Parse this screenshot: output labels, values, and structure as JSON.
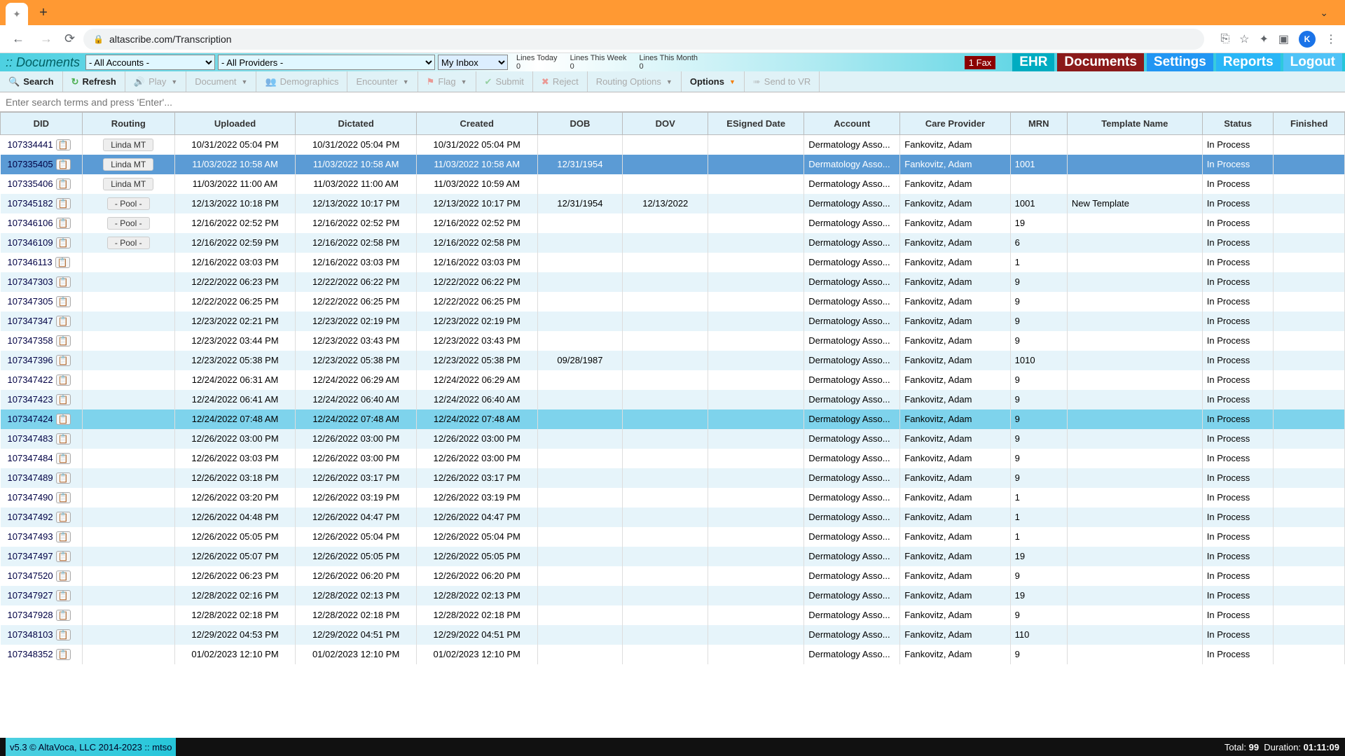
{
  "browser": {
    "url": "altascribe.com/Transcription"
  },
  "header": {
    "title": ":: Documents",
    "accounts": "- All Accounts -",
    "providers": "- All Providers -",
    "inbox": "My Inbox",
    "stats": [
      {
        "label": "Lines Today",
        "value": "0"
      },
      {
        "label": "Lines This Week",
        "value": "0"
      },
      {
        "label": "Lines This Month",
        "value": "0"
      }
    ],
    "fax": "1 Fax",
    "nav": {
      "ehr": "EHR",
      "documents": "Documents",
      "settings": "Settings",
      "reports": "Reports",
      "logout": "Logout"
    }
  },
  "toolbar": {
    "search": "Search",
    "refresh": "Refresh",
    "play": "Play",
    "document": "Document",
    "demographics": "Demographics",
    "encounter": "Encounter",
    "flag": "Flag",
    "submit": "Submit",
    "reject": "Reject",
    "routing": "Routing Options",
    "options": "Options",
    "sendvr": "Send to VR"
  },
  "search_placeholder": "Enter search terms and press 'Enter'...",
  "columns": [
    "DID",
    "Routing",
    "Uploaded",
    "Dictated",
    "Created",
    "DOB",
    "DOV",
    "ESigned Date",
    "Account",
    "Care Provider",
    "MRN",
    "Template Name",
    "Status",
    "Finished"
  ],
  "rows": [
    {
      "did": "107334441",
      "routing": "Linda MT",
      "uploaded": "10/31/2022 05:04 PM",
      "dictated": "10/31/2022 05:04 PM",
      "created": "10/31/2022 05:04 PM",
      "dob": "",
      "dov": "",
      "esig": "",
      "acct": "Dermatology Asso...",
      "prov": "Fankovitz, Adam",
      "mrn": "",
      "tmpl": "",
      "status": "In Process",
      "fin": "",
      "sel": ""
    },
    {
      "did": "107335405",
      "routing": "Linda MT",
      "uploaded": "11/03/2022 10:58 AM",
      "dictated": "11/03/2022 10:58 AM",
      "created": "11/03/2022 10:58 AM",
      "dob": "12/31/1954",
      "dov": "",
      "esig": "",
      "acct": "Dermatology Asso...",
      "prov": "Fankovitz, Adam",
      "mrn": "1001",
      "tmpl": "",
      "status": "In Process",
      "fin": "",
      "sel": "dark"
    },
    {
      "did": "107335406",
      "routing": "Linda MT",
      "uploaded": "11/03/2022 11:00 AM",
      "dictated": "11/03/2022 11:00 AM",
      "created": "11/03/2022 10:59 AM",
      "dob": "",
      "dov": "",
      "esig": "",
      "acct": "Dermatology Asso...",
      "prov": "Fankovitz, Adam",
      "mrn": "",
      "tmpl": "",
      "status": "In Process",
      "fin": "",
      "sel": ""
    },
    {
      "did": "107345182",
      "routing": "- Pool -",
      "uploaded": "12/13/2022 10:18 PM",
      "dictated": "12/13/2022 10:17 PM",
      "created": "12/13/2022 10:17 PM",
      "dob": "12/31/1954",
      "dov": "12/13/2022",
      "esig": "",
      "acct": "Dermatology Asso...",
      "prov": "Fankovitz, Adam",
      "mrn": "1001",
      "tmpl": "New Template",
      "status": "In Process",
      "fin": "",
      "sel": ""
    },
    {
      "did": "107346106",
      "routing": "- Pool -",
      "uploaded": "12/16/2022 02:52 PM",
      "dictated": "12/16/2022 02:52 PM",
      "created": "12/16/2022 02:52 PM",
      "dob": "",
      "dov": "",
      "esig": "",
      "acct": "Dermatology Asso...",
      "prov": "Fankovitz, Adam",
      "mrn": "19",
      "tmpl": "",
      "status": "In Process",
      "fin": "",
      "sel": ""
    },
    {
      "did": "107346109",
      "routing": "- Pool -",
      "uploaded": "12/16/2022 02:59 PM",
      "dictated": "12/16/2022 02:58 PM",
      "created": "12/16/2022 02:58 PM",
      "dob": "",
      "dov": "",
      "esig": "",
      "acct": "Dermatology Asso...",
      "prov": "Fankovitz, Adam",
      "mrn": "6",
      "tmpl": "",
      "status": "In Process",
      "fin": "",
      "sel": ""
    },
    {
      "did": "107346113",
      "routing": "",
      "uploaded": "12/16/2022 03:03 PM",
      "dictated": "12/16/2022 03:03 PM",
      "created": "12/16/2022 03:03 PM",
      "dob": "",
      "dov": "",
      "esig": "",
      "acct": "Dermatology Asso...",
      "prov": "Fankovitz, Adam",
      "mrn": "1",
      "tmpl": "",
      "status": "In Process",
      "fin": "",
      "sel": ""
    },
    {
      "did": "107347303",
      "routing": "",
      "uploaded": "12/22/2022 06:23 PM",
      "dictated": "12/22/2022 06:22 PM",
      "created": "12/22/2022 06:22 PM",
      "dob": "",
      "dov": "",
      "esig": "",
      "acct": "Dermatology Asso...",
      "prov": "Fankovitz, Adam",
      "mrn": "9",
      "tmpl": "",
      "status": "In Process",
      "fin": "",
      "sel": ""
    },
    {
      "did": "107347305",
      "routing": "",
      "uploaded": "12/22/2022 06:25 PM",
      "dictated": "12/22/2022 06:25 PM",
      "created": "12/22/2022 06:25 PM",
      "dob": "",
      "dov": "",
      "esig": "",
      "acct": "Dermatology Asso...",
      "prov": "Fankovitz, Adam",
      "mrn": "9",
      "tmpl": "",
      "status": "In Process",
      "fin": "",
      "sel": ""
    },
    {
      "did": "107347347",
      "routing": "",
      "uploaded": "12/23/2022 02:21 PM",
      "dictated": "12/23/2022 02:19 PM",
      "created": "12/23/2022 02:19 PM",
      "dob": "",
      "dov": "",
      "esig": "",
      "acct": "Dermatology Asso...",
      "prov": "Fankovitz, Adam",
      "mrn": "9",
      "tmpl": "",
      "status": "In Process",
      "fin": "",
      "sel": ""
    },
    {
      "did": "107347358",
      "routing": "",
      "uploaded": "12/23/2022 03:44 PM",
      "dictated": "12/23/2022 03:43 PM",
      "created": "12/23/2022 03:43 PM",
      "dob": "",
      "dov": "",
      "esig": "",
      "acct": "Dermatology Asso...",
      "prov": "Fankovitz, Adam",
      "mrn": "9",
      "tmpl": "",
      "status": "In Process",
      "fin": "",
      "sel": ""
    },
    {
      "did": "107347396",
      "routing": "",
      "uploaded": "12/23/2022 05:38 PM",
      "dictated": "12/23/2022 05:38 PM",
      "created": "12/23/2022 05:38 PM",
      "dob": "09/28/1987",
      "dov": "",
      "esig": "",
      "acct": "Dermatology Asso...",
      "prov": "Fankovitz, Adam",
      "mrn": "1010",
      "tmpl": "",
      "status": "In Process",
      "fin": "",
      "sel": ""
    },
    {
      "did": "107347422",
      "routing": "",
      "uploaded": "12/24/2022 06:31 AM",
      "dictated": "12/24/2022 06:29 AM",
      "created": "12/24/2022 06:29 AM",
      "dob": "",
      "dov": "",
      "esig": "",
      "acct": "Dermatology Asso...",
      "prov": "Fankovitz, Adam",
      "mrn": "9",
      "tmpl": "",
      "status": "In Process",
      "fin": "",
      "sel": ""
    },
    {
      "did": "107347423",
      "routing": "",
      "uploaded": "12/24/2022 06:41 AM",
      "dictated": "12/24/2022 06:40 AM",
      "created": "12/24/2022 06:40 AM",
      "dob": "",
      "dov": "",
      "esig": "",
      "acct": "Dermatology Asso...",
      "prov": "Fankovitz, Adam",
      "mrn": "9",
      "tmpl": "",
      "status": "In Process",
      "fin": "",
      "sel": ""
    },
    {
      "did": "107347424",
      "routing": "",
      "uploaded": "12/24/2022 07:48 AM",
      "dictated": "12/24/2022 07:48 AM",
      "created": "12/24/2022 07:48 AM",
      "dob": "",
      "dov": "",
      "esig": "",
      "acct": "Dermatology Asso...",
      "prov": "Fankovitz, Adam",
      "mrn": "9",
      "tmpl": "",
      "status": "In Process",
      "fin": "",
      "sel": "light"
    },
    {
      "did": "107347483",
      "routing": "",
      "uploaded": "12/26/2022 03:00 PM",
      "dictated": "12/26/2022 03:00 PM",
      "created": "12/26/2022 03:00 PM",
      "dob": "",
      "dov": "",
      "esig": "",
      "acct": "Dermatology Asso...",
      "prov": "Fankovitz, Adam",
      "mrn": "9",
      "tmpl": "",
      "status": "In Process",
      "fin": "",
      "sel": ""
    },
    {
      "did": "107347484",
      "routing": "",
      "uploaded": "12/26/2022 03:03 PM",
      "dictated": "12/26/2022 03:00 PM",
      "created": "12/26/2022 03:00 PM",
      "dob": "",
      "dov": "",
      "esig": "",
      "acct": "Dermatology Asso...",
      "prov": "Fankovitz, Adam",
      "mrn": "9",
      "tmpl": "",
      "status": "In Process",
      "fin": "",
      "sel": ""
    },
    {
      "did": "107347489",
      "routing": "",
      "uploaded": "12/26/2022 03:18 PM",
      "dictated": "12/26/2022 03:17 PM",
      "created": "12/26/2022 03:17 PM",
      "dob": "",
      "dov": "",
      "esig": "",
      "acct": "Dermatology Asso...",
      "prov": "Fankovitz, Adam",
      "mrn": "9",
      "tmpl": "",
      "status": "In Process",
      "fin": "",
      "sel": ""
    },
    {
      "did": "107347490",
      "routing": "",
      "uploaded": "12/26/2022 03:20 PM",
      "dictated": "12/26/2022 03:19 PM",
      "created": "12/26/2022 03:19 PM",
      "dob": "",
      "dov": "",
      "esig": "",
      "acct": "Dermatology Asso...",
      "prov": "Fankovitz, Adam",
      "mrn": "1",
      "tmpl": "",
      "status": "In Process",
      "fin": "",
      "sel": ""
    },
    {
      "did": "107347492",
      "routing": "",
      "uploaded": "12/26/2022 04:48 PM",
      "dictated": "12/26/2022 04:47 PM",
      "created": "12/26/2022 04:47 PM",
      "dob": "",
      "dov": "",
      "esig": "",
      "acct": "Dermatology Asso...",
      "prov": "Fankovitz, Adam",
      "mrn": "1",
      "tmpl": "",
      "status": "In Process",
      "fin": "",
      "sel": ""
    },
    {
      "did": "107347493",
      "routing": "",
      "uploaded": "12/26/2022 05:05 PM",
      "dictated": "12/26/2022 05:04 PM",
      "created": "12/26/2022 05:04 PM",
      "dob": "",
      "dov": "",
      "esig": "",
      "acct": "Dermatology Asso...",
      "prov": "Fankovitz, Adam",
      "mrn": "1",
      "tmpl": "",
      "status": "In Process",
      "fin": "",
      "sel": ""
    },
    {
      "did": "107347497",
      "routing": "",
      "uploaded": "12/26/2022 05:07 PM",
      "dictated": "12/26/2022 05:05 PM",
      "created": "12/26/2022 05:05 PM",
      "dob": "",
      "dov": "",
      "esig": "",
      "acct": "Dermatology Asso...",
      "prov": "Fankovitz, Adam",
      "mrn": "19",
      "tmpl": "",
      "status": "In Process",
      "fin": "",
      "sel": ""
    },
    {
      "did": "107347520",
      "routing": "",
      "uploaded": "12/26/2022 06:23 PM",
      "dictated": "12/26/2022 06:20 PM",
      "created": "12/26/2022 06:20 PM",
      "dob": "",
      "dov": "",
      "esig": "",
      "acct": "Dermatology Asso...",
      "prov": "Fankovitz, Adam",
      "mrn": "9",
      "tmpl": "",
      "status": "In Process",
      "fin": "",
      "sel": ""
    },
    {
      "did": "107347927",
      "routing": "",
      "uploaded": "12/28/2022 02:16 PM",
      "dictated": "12/28/2022 02:13 PM",
      "created": "12/28/2022 02:13 PM",
      "dob": "",
      "dov": "",
      "esig": "",
      "acct": "Dermatology Asso...",
      "prov": "Fankovitz, Adam",
      "mrn": "19",
      "tmpl": "",
      "status": "In Process",
      "fin": "",
      "sel": ""
    },
    {
      "did": "107347928",
      "routing": "",
      "uploaded": "12/28/2022 02:18 PM",
      "dictated": "12/28/2022 02:18 PM",
      "created": "12/28/2022 02:18 PM",
      "dob": "",
      "dov": "",
      "esig": "",
      "acct": "Dermatology Asso...",
      "prov": "Fankovitz, Adam",
      "mrn": "9",
      "tmpl": "",
      "status": "In Process",
      "fin": "",
      "sel": ""
    },
    {
      "did": "107348103",
      "routing": "",
      "uploaded": "12/29/2022 04:53 PM",
      "dictated": "12/29/2022 04:51 PM",
      "created": "12/29/2022 04:51 PM",
      "dob": "",
      "dov": "",
      "esig": "",
      "acct": "Dermatology Asso...",
      "prov": "Fankovitz, Adam",
      "mrn": "110",
      "tmpl": "",
      "status": "In Process",
      "fin": "",
      "sel": ""
    },
    {
      "did": "107348352",
      "routing": "",
      "uploaded": "01/02/2023 12:10 PM",
      "dictated": "01/02/2023 12:10 PM",
      "created": "01/02/2023 12:10 PM",
      "dob": "",
      "dov": "",
      "esig": "",
      "acct": "Dermatology Asso...",
      "prov": "Fankovitz, Adam",
      "mrn": "9",
      "tmpl": "",
      "status": "In Process",
      "fin": "",
      "sel": ""
    }
  ],
  "footer": {
    "left": "v5.3 © AltaVoca, LLC 2014-2023 :: mtso",
    "total_label": "Total:",
    "total": "99",
    "dur_label": "Duration:",
    "dur": "01:11:09"
  }
}
